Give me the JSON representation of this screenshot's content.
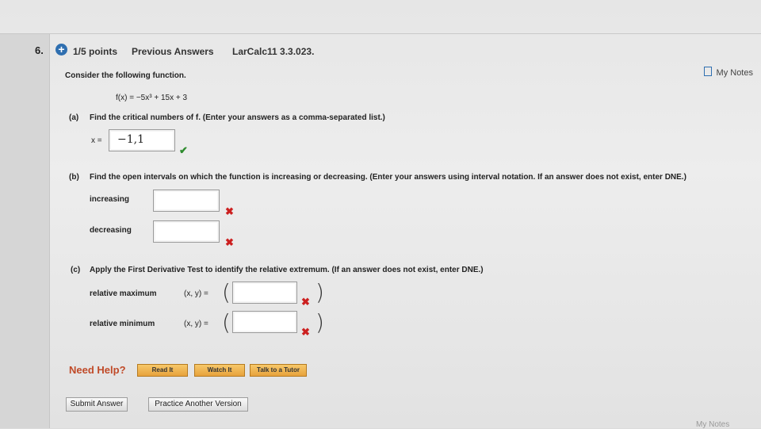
{
  "question": {
    "number": "6.",
    "points": "1/5 points",
    "previous_answers": "Previous Answers",
    "source": "LarCalc11 3.3.023.",
    "my_notes": "My Notes",
    "intro": "Consider the following function.",
    "function": "f(x) = −5x³ + 15x + 3"
  },
  "part_a": {
    "label": "(a)",
    "prompt": "Find the critical numbers of f. (Enter your answers as a comma-separated list.)",
    "var_label": "x =",
    "answer": "−1,1",
    "status": "✔"
  },
  "part_b": {
    "label": "(b)",
    "prompt": "Find the open intervals on which the function is increasing or decreasing. (Enter your answers using interval notation. If an answer does not exist, enter DNE.)",
    "increasing_label": "increasing",
    "decreasing_label": "decreasing",
    "increasing_value": "",
    "decreasing_value": "",
    "status": "✖"
  },
  "part_c": {
    "label": "(c)",
    "prompt": "Apply the First Derivative Test to identify the relative extremum. (If an answer does not exist, enter DNE.)",
    "max_label": "relative maximum",
    "min_label": "relative minimum",
    "xy_label": "(x, y) =",
    "open_paren": "(",
    "close_paren": ")",
    "max_value": "",
    "min_value": "",
    "status": "✖"
  },
  "help": {
    "label": "Need Help?",
    "read": "Read It",
    "watch": "Watch It",
    "tutor": "Talk to a Tutor"
  },
  "actions": {
    "submit": "Submit Answer",
    "practice": "Practice Another Version"
  },
  "footer": {
    "my_notes": "My Notes"
  }
}
